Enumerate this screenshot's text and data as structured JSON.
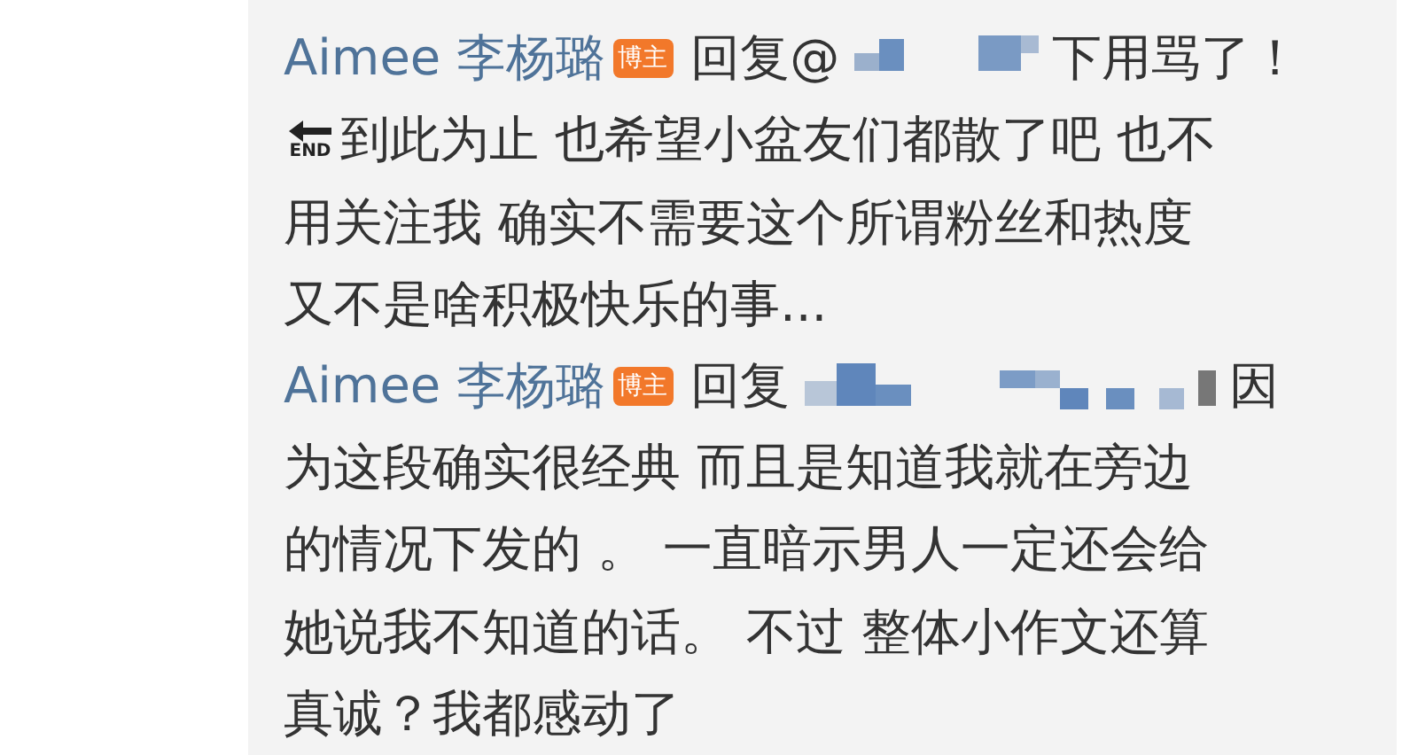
{
  "comments": [
    {
      "author": "Aimee 李杨璐",
      "badge": "博主",
      "reply_prefix": "回复@",
      "reply_tail": "下用骂了！",
      "lines": [
        {
          "kind": "sign",
          "sign_label": "END",
          "text": "到此为止 也希望小盆友们都散了吧 也不"
        },
        {
          "kind": "plain",
          "text": "用关注我 确实不需要这个所谓粉丝和热度"
        },
        {
          "kind": "plain",
          "text": "又不是啥积极快乐的事..."
        }
      ]
    },
    {
      "author": "Aimee 李杨璐",
      "badge": "博主",
      "reply_prefix": "回复",
      "reply_tail": "因",
      "lines": [
        {
          "kind": "plain",
          "text": "为这段确实很经典  而且是知道我就在旁边"
        },
        {
          "kind": "plain",
          "text": "的情况下发的 。 一直暗示男人一定还会给"
        },
        {
          "kind": "plain",
          "text": "她说我不知道的话。 不过 整体小作文还算"
        },
        {
          "kind": "plain",
          "text": "真诚？我都感动了"
        }
      ]
    }
  ]
}
